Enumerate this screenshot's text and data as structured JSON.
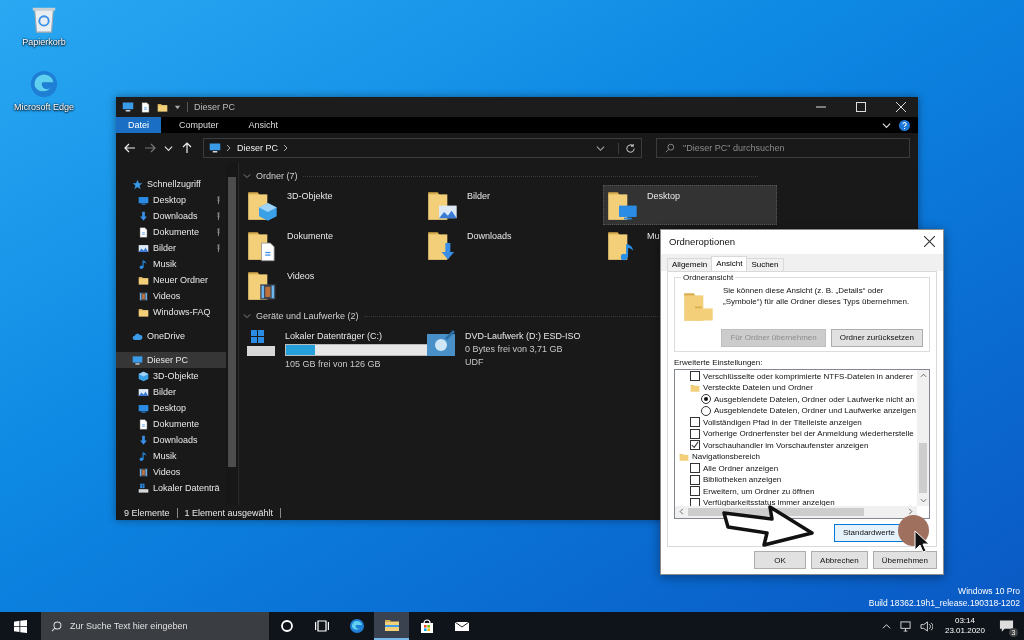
{
  "desktop_icons": [
    {
      "label": "Papierkorb",
      "kind": "bin"
    },
    {
      "label": "Microsoft Edge",
      "kind": "edge"
    }
  ],
  "explorer": {
    "title": "Dieser PC",
    "ribbon_tabs": [
      {
        "label": "Datei",
        "selected": true
      },
      {
        "label": "Computer",
        "selected": false
      },
      {
        "label": "Ansicht",
        "selected": false
      }
    ],
    "address": "Dieser PC",
    "search_placeholder": "\"Dieser PC\" durchsuchen",
    "sidebar": [
      {
        "label": "Schnellzugriff",
        "kind": "star",
        "selected": false,
        "children": [
          {
            "label": "Desktop",
            "kind": "desktop",
            "selected": false,
            "pinned": true
          },
          {
            "label": "Downloads",
            "kind": "download",
            "selected": false,
            "pinned": true
          },
          {
            "label": "Dokumente",
            "kind": "document",
            "selected": false,
            "pinned": true
          },
          {
            "label": "Bilder",
            "kind": "picture",
            "selected": false,
            "pinned": true
          },
          {
            "label": "Musik",
            "kind": "music",
            "selected": false,
            "pinned": false
          },
          {
            "label": "Neuer Ordner",
            "kind": "folder",
            "selected": false,
            "pinned": false
          },
          {
            "label": "Videos",
            "kind": "video",
            "selected": false,
            "pinned": false
          },
          {
            "label": "Windows-FAQ",
            "kind": "folder",
            "selected": false,
            "pinned": false
          }
        ]
      },
      {
        "label": "OneDrive",
        "kind": "cloud",
        "selected": false
      },
      {
        "label": "Dieser PC",
        "kind": "pc",
        "selected": true,
        "children": [
          {
            "label": "3D-Objekte",
            "kind": "cube",
            "selected": false,
            "pinned": false
          },
          {
            "label": "Bilder",
            "kind": "picture",
            "selected": false,
            "pinned": false
          },
          {
            "label": "Desktop",
            "kind": "desktop",
            "selected": false,
            "pinned": false
          },
          {
            "label": "Dokumente",
            "kind": "document",
            "selected": false,
            "pinned": false
          },
          {
            "label": "Downloads",
            "kind": "download",
            "selected": false,
            "pinned": false
          },
          {
            "label": "Musik",
            "kind": "music",
            "selected": false,
            "pinned": false
          },
          {
            "label": "Videos",
            "kind": "video",
            "selected": false,
            "pinned": false
          },
          {
            "label": "Lokaler Datenträ",
            "kind": "drive",
            "selected": false,
            "pinned": false
          }
        ]
      }
    ],
    "groups": [
      {
        "title": "Ordner (7)",
        "items": [
          {
            "label": "3D-Objekte",
            "kind": "cube",
            "selected": false
          },
          {
            "label": "Bilder",
            "kind": "picture",
            "selected": false
          },
          {
            "label": "Desktop",
            "kind": "desktop",
            "selected": true
          },
          {
            "label": "Dokumente",
            "kind": "document",
            "selected": false
          },
          {
            "label": "Downloads",
            "kind": "download",
            "selected": false
          },
          {
            "label": "Mu",
            "kind": "music",
            "selected": false
          },
          {
            "label": "Videos",
            "kind": "video",
            "selected": false
          }
        ]
      },
      {
        "title": "Geräte und Laufwerke (2)",
        "items": [
          {
            "label": "Lokaler Datenträger (C:)",
            "kind": "drive",
            "selected": false,
            "level": 0.17,
            "details": [
              "105 GB frei von 126 GB"
            ]
          },
          {
            "label": "DVD-Laufwerk (D:) ESD-ISO",
            "kind": "dvd",
            "selected": false,
            "details": [
              "0 Bytes frei von 3,71 GB",
              "UDF"
            ]
          }
        ]
      }
    ],
    "status_bar": [
      "9 Elemente",
      "1 Element ausgewählt"
    ]
  },
  "dialog": {
    "title": "Ordneroptionen",
    "tabs": [
      {
        "label": "Allgemein",
        "selected": false
      },
      {
        "label": "Ansicht",
        "selected": true
      },
      {
        "label": "Suchen",
        "selected": false
      }
    ],
    "folder_view": {
      "title": "Ordneransicht",
      "text": "Sie können diese Ansicht (z. B. „Details“ oder „Symbole“) für alle Ordner dieses Typs übernehmen.",
      "buttons": [
        {
          "label": "Für Ordner übernehmen",
          "disabled": true
        },
        {
          "label": "Ordner zurücksetzen",
          "disabled": false
        }
      ]
    },
    "advanced_label": "Erweiterte Einstellungen:",
    "settings": [
      {
        "kind": "continued",
        "children": [
          {
            "kind": "checkbox",
            "label": "Verschlüsselte oder komprimierte NTFS-Dateien in anderer",
            "checked": false
          },
          {
            "kind": "folder",
            "label": "Versteckte Dateien und Ordner",
            "children": [
              {
                "kind": "radio",
                "label": "Ausgeblendete Dateien, Ordner oder Laufwerke nicht an",
                "checked": true
              },
              {
                "kind": "radio",
                "label": "Ausgeblendete Dateien, Ordner und Laufwerke anzeigen",
                "checked": false
              }
            ]
          },
          {
            "kind": "checkbox",
            "label": "Vollständigen Pfad in der Titelleiste anzeigen",
            "checked": false
          },
          {
            "kind": "checkbox",
            "label": "Vorherige Ordnerfenster bei der Anmeldung wiederherstelle",
            "checked": false
          },
          {
            "kind": "checkbox",
            "label": "Vorschauhandler im Vorschaufenster anzeigen",
            "checked": true
          }
        ]
      },
      {
        "kind": "folder",
        "label": "Navigationsbereich",
        "children": [
          {
            "kind": "checkbox",
            "label": "Alle Ordner anzeigen",
            "checked": false
          },
          {
            "kind": "checkbox",
            "label": "Bibliotheken anzeigen",
            "checked": false
          },
          {
            "kind": "checkbox",
            "label": "Erweitern, um Ordner zu öffnen",
            "checked": false
          },
          {
            "kind": "checkbox",
            "label": "Verfügbarkeitsstatus immer anzeigen",
            "checked": false
          }
        ]
      }
    ],
    "defaults_button": "Standardwerte",
    "buttons": [
      "OK",
      "Abbrechen",
      "Übernehmen"
    ]
  },
  "version_info": [
    "Windows 10 Pro",
    "Build 18362.19h1_release.190318-1202"
  ],
  "taskbar": {
    "search_placeholder": "Zur Suche Text hier eingeben",
    "apps": [
      {
        "kind": "cortana",
        "active": false
      },
      {
        "kind": "taskview",
        "active": false
      },
      {
        "kind": "edge",
        "active": false
      },
      {
        "kind": "explorer",
        "active": true
      },
      {
        "kind": "store",
        "active": false
      },
      {
        "kind": "mail",
        "active": false
      }
    ],
    "time": "03:14",
    "date": "23.01.2020",
    "notifications": "3"
  }
}
